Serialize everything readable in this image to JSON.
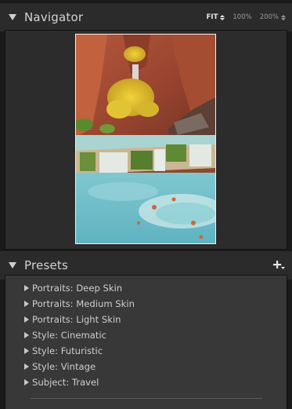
{
  "navigator": {
    "title": "Navigator",
    "zoom_options": [
      {
        "label": "FIT",
        "active": true
      },
      {
        "label": "100%",
        "active": false
      },
      {
        "label": "200%",
        "active": false
      }
    ]
  },
  "presets": {
    "title": "Presets",
    "items": [
      {
        "label": "Portraits: Deep Skin"
      },
      {
        "label": "Portraits: Medium Skin"
      },
      {
        "label": "Portraits: Light Skin"
      },
      {
        "label": "Style: Cinematic"
      },
      {
        "label": "Style: Futuristic"
      },
      {
        "label": "Style: Vintage"
      },
      {
        "label": "Subject: Travel"
      }
    ]
  },
  "colors": {
    "panel_header_bg": "#2b2b2b",
    "panel_body_bg": "#383838",
    "text": "#cdcdcd"
  },
  "icons": [
    "collapse-triangle-icon",
    "zoom-updown-icon",
    "add-preset-icon",
    "expand-triangle-icon"
  ]
}
